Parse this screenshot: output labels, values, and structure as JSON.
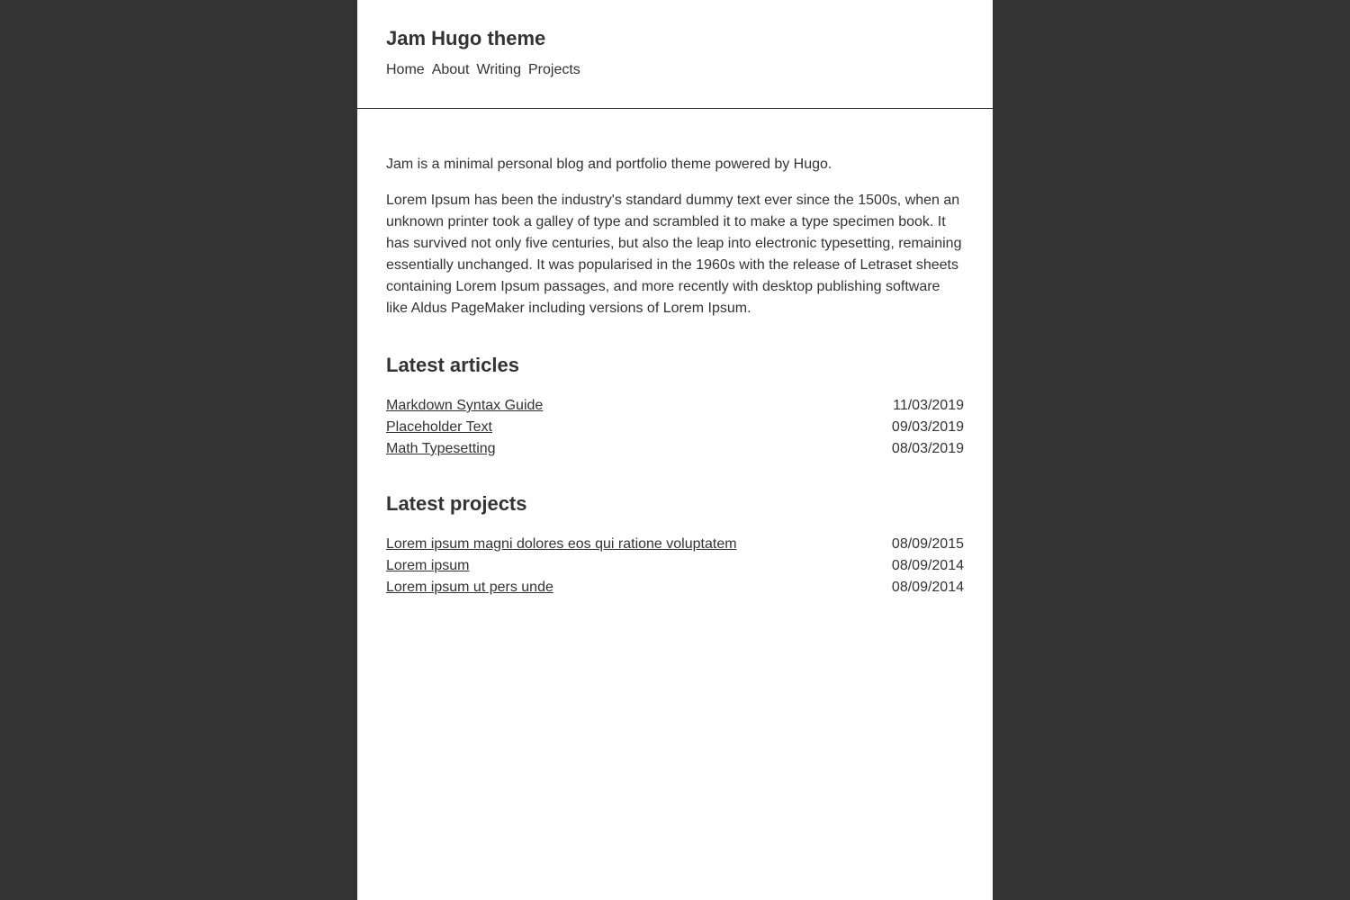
{
  "site": {
    "title": "Jam Hugo theme"
  },
  "nav": {
    "items": [
      "Home",
      "About",
      "Writing",
      "Projects"
    ]
  },
  "intro": {
    "tagline": "Jam is a minimal personal blog and portfolio theme powered by Hugo.",
    "body": "Lorem Ipsum has been the industry's standard dummy text ever since the 1500s, when an unknown printer took a galley of type and scrambled it to make a type specimen book. It has survived not only five centuries, but also the leap into electronic typesetting, remaining essentially unchanged. It was popularised in the 1960s with the release of Letraset sheets containing Lorem Ipsum passages, and more recently with desktop publishing software like Aldus PageMaker including versions of Lorem Ipsum."
  },
  "articles": {
    "heading": "Latest articles",
    "items": [
      {
        "title": "Markdown Syntax Guide",
        "date": "11/03/2019"
      },
      {
        "title": "Placeholder Text",
        "date": "09/03/2019"
      },
      {
        "title": "Math Typesetting",
        "date": "08/03/2019"
      }
    ]
  },
  "projects": {
    "heading": "Latest projects",
    "items": [
      {
        "title": "Lorem ipsum magni dolores eos qui ratione voluptatem",
        "date": "08/09/2015"
      },
      {
        "title": "Lorem ipsum",
        "date": "08/09/2014"
      },
      {
        "title": "Lorem ipsum ut pers unde",
        "date": "08/09/2014"
      }
    ]
  },
  "colors": {
    "background": "#333333",
    "page": "#ffffff",
    "text": "#333333"
  }
}
